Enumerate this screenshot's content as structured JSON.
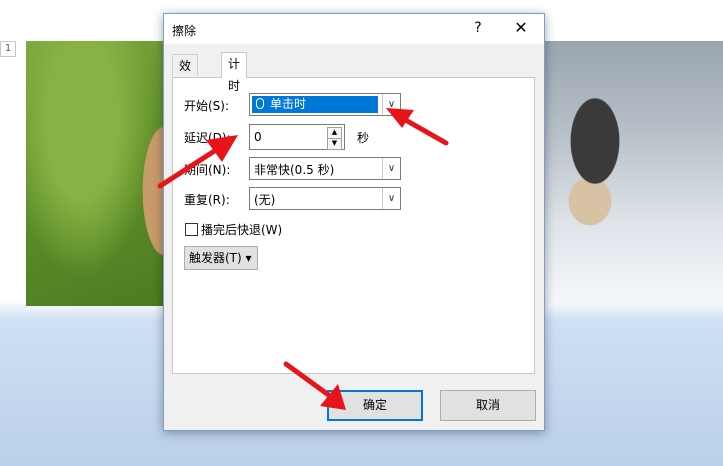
{
  "slide": {
    "number": "1"
  },
  "dialog": {
    "title": "擦除",
    "help_label": "?",
    "close_label": "✕",
    "tabs": [
      {
        "label": "效果"
      },
      {
        "label": "计时"
      }
    ],
    "fields": {
      "start": {
        "label": "开始(S):",
        "value": "单击时"
      },
      "delay": {
        "label": "延迟(D):",
        "value": "0",
        "unit": "秒"
      },
      "duration": {
        "label": "期间(N):",
        "value": "非常快(0.5 秒)"
      },
      "repeat": {
        "label": "重复(R):",
        "value": "(无)"
      },
      "rewind": {
        "label": "播完后快退(W)",
        "checked": false
      }
    },
    "trigger_label": "触发器(T) ▾",
    "ok_label": "确定",
    "cancel_label": "取消"
  },
  "colors": {
    "arrow": "#e8141b",
    "accent": "#0078d7"
  },
  "icons": {
    "dropdown": "chevron-down-icon",
    "close": "close-icon",
    "mouse": "mouse-icon"
  }
}
